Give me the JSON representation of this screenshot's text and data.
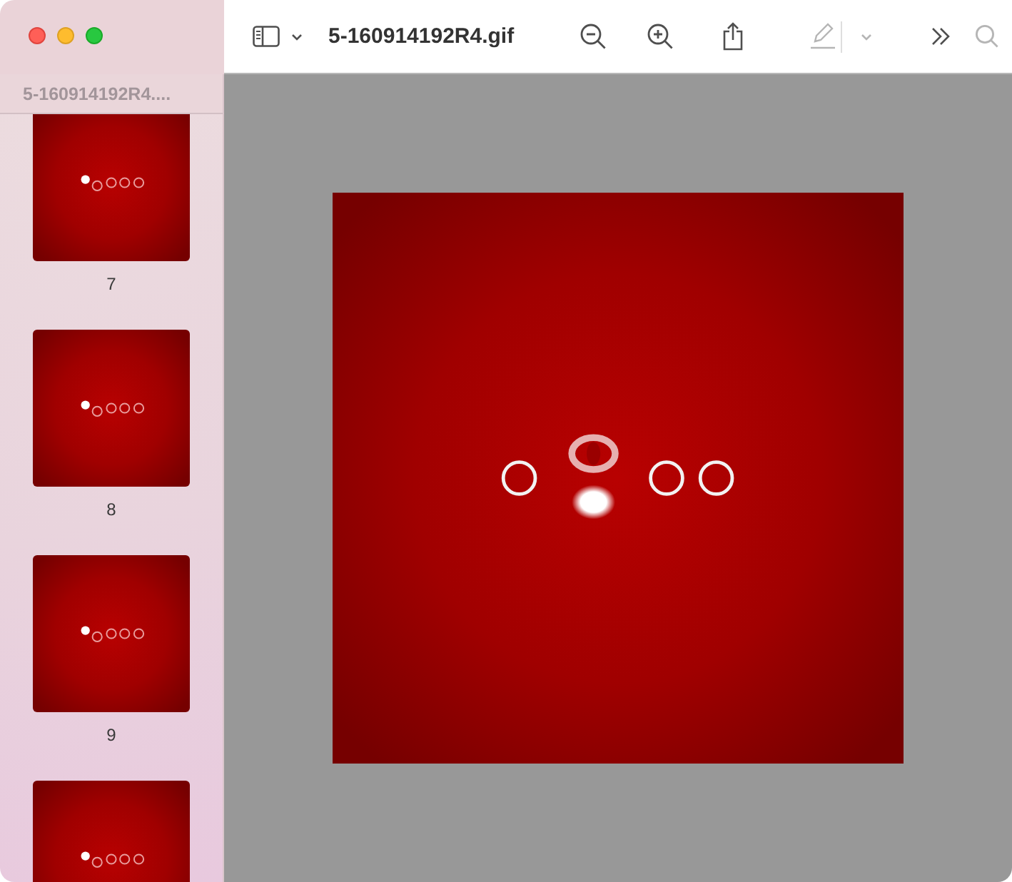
{
  "window": {
    "title": "5-160914192R4.gif"
  },
  "toolbar": [
    {
      "kind": "sidebar",
      "disabled": false
    },
    {
      "kind": "chevron",
      "disabled": false
    },
    {
      "kind": "zoom-out",
      "disabled": false
    },
    {
      "kind": "zoom-in",
      "disabled": false
    },
    {
      "kind": "share",
      "disabled": false
    },
    {
      "kind": "markup",
      "disabled": true
    },
    {
      "kind": "markup-menu",
      "disabled": true
    },
    {
      "kind": "more",
      "disabled": false
    },
    {
      "kind": "search",
      "disabled": true
    }
  ],
  "sidebar": {
    "header": "5-160914192R4....",
    "thumbnails": [
      {
        "label": "7",
        "kind": "picture"
      },
      {
        "label": "8",
        "kind": "picture"
      },
      {
        "label": "9",
        "kind": "picture"
      },
      {
        "kind": "picture"
      }
    ]
  },
  "viewer": {
    "image": {
      "kind": "picture"
    }
  }
}
